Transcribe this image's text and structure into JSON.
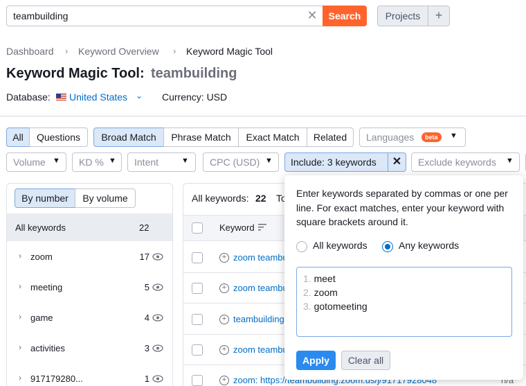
{
  "search": {
    "value": "teambuilding",
    "clear_icon": "close-icon",
    "button_label": "Search"
  },
  "projects": {
    "label": "Projects",
    "add_label": "+"
  },
  "breadcrumb": [
    "Dashboard",
    "Keyword Overview",
    "Keyword Magic Tool"
  ],
  "page": {
    "title": "Keyword Magic Tool:",
    "query": "teambuilding"
  },
  "database": {
    "label": "Database:",
    "value": "United States",
    "flag_icon": "us-flag-icon"
  },
  "currency": {
    "text": "Currency: USD"
  },
  "tabs": {
    "type": [
      "All",
      "Questions"
    ],
    "match": [
      "Broad Match",
      "Phrase Match",
      "Exact Match",
      "Related"
    ],
    "languages": "Languages",
    "beta": "beta"
  },
  "filters": {
    "volume": "Volume",
    "kd": "KD %",
    "intent": "Intent",
    "cpc": "CPC (USD)",
    "include": "Include: 3 keywords",
    "exclude": "Exclude keywords"
  },
  "groups": {
    "sort": [
      "By number",
      "By volume"
    ],
    "all_label": "All keywords",
    "all_count": "22",
    "items": [
      {
        "label": "zoom",
        "count": "17"
      },
      {
        "label": "meeting",
        "count": "5"
      },
      {
        "label": "game",
        "count": "4"
      },
      {
        "label": "activities",
        "count": "3"
      },
      {
        "label": "917179280...",
        "count": "1"
      }
    ]
  },
  "table": {
    "summary_label": "All keywords:",
    "summary_count": "22",
    "summary_more": "To",
    "col_keyword": "Keyword",
    "rows": [
      "zoom teambu",
      "zoom teambu",
      "teambuilding",
      "zoom teambu",
      "zoom: https://teambuilding.zoom.us/j/91717928048"
    ],
    "last_cell": "n/a"
  },
  "popover": {
    "instructions": "Enter keywords separated by commas or one per line. For exact matches, enter your keyword with square brackets around it.",
    "radio_all": "All keywords",
    "radio_any": "Any keywords",
    "selected": "Any keywords",
    "keywords": [
      "meet",
      "zoom",
      "gotomeeting"
    ],
    "line_numbers": [
      "1.",
      "2.",
      "3."
    ],
    "apply_label": "Apply",
    "clear_label": "Clear all"
  },
  "colors": {
    "accent": "#ff642d",
    "link": "#006dca",
    "primary": "#2b8af0",
    "active_bg": "#dbe8f7"
  }
}
